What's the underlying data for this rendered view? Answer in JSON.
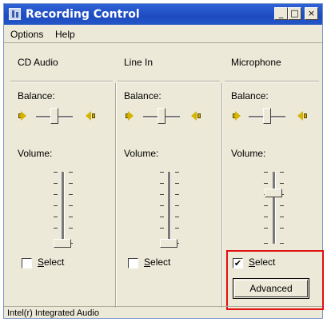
{
  "window": {
    "title": "Recording Control"
  },
  "menu": {
    "options": "Options",
    "help": "Help"
  },
  "columns": [
    {
      "title": "CD Audio",
      "balance_label": "Balance:",
      "volume_label": "Volume:",
      "select_label": "Select",
      "selected": false,
      "volume_level": 0.0
    },
    {
      "title": "Line In",
      "balance_label": "Balance:",
      "volume_label": "Volume:",
      "select_label": "Select",
      "selected": false,
      "volume_level": 0.0
    },
    {
      "title": "Microphone",
      "balance_label": "Balance:",
      "volume_label": "Volume:",
      "select_label": "Select",
      "selected": true,
      "volume_level": 0.75,
      "advanced_label": "Advanced"
    }
  ],
  "status": {
    "text": "Intel(r) Integrated Audio"
  },
  "colors": {
    "titlebar": "#1d4bbf",
    "highlight": "#e01010",
    "face": "#ece9d8"
  }
}
